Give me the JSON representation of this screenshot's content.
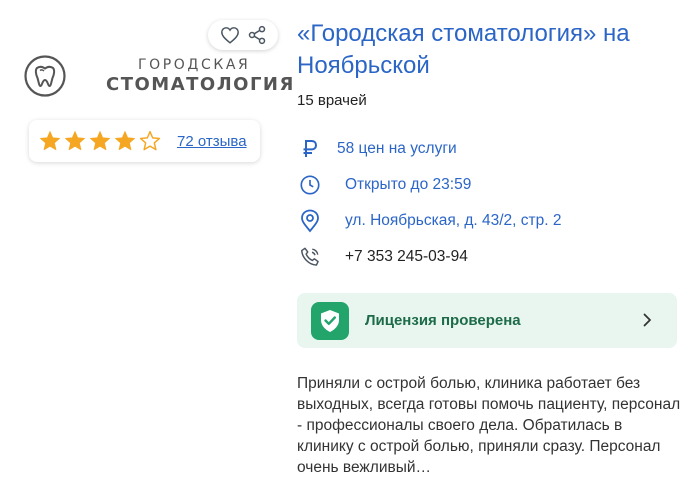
{
  "clinic": {
    "title": "«Городская стоматология» на Ноябрьской",
    "doctors_count": "15 врачей"
  },
  "logo": {
    "line1": "Городская",
    "line2": "Стоматология"
  },
  "rating": {
    "value": 4,
    "max": 5,
    "reviews_link": "72 отзыва",
    "star_color": "#f5a623"
  },
  "info": {
    "prices": "58 цен на услуги",
    "hours": "Открыто до 23:59",
    "address": "ул. Ноябрьская, д. 43/2, стр. 2",
    "phone": "+7 353 245-03-94"
  },
  "license": {
    "label": "Лицензия проверена",
    "color": "#23a46b"
  },
  "review_excerpt": "Приняли с острой болью, клиника работает без выходных, всегда готовы помочь пациенту, персонал - профессионалы своего дела. Обратилась в клинику с острой болью, приняли сразу. Персонал очень вежливый…",
  "colors": {
    "link": "#2b66c7",
    "license_bg": "#e8f6ef"
  },
  "icons": {
    "favorite": "heart-icon",
    "share": "share-icon",
    "prices": "ruble-icon",
    "hours": "clock-icon",
    "address": "location-pin-icon",
    "phone": "phone-icon",
    "license": "shield-check-icon",
    "license_more": "chevron-right-icon"
  }
}
